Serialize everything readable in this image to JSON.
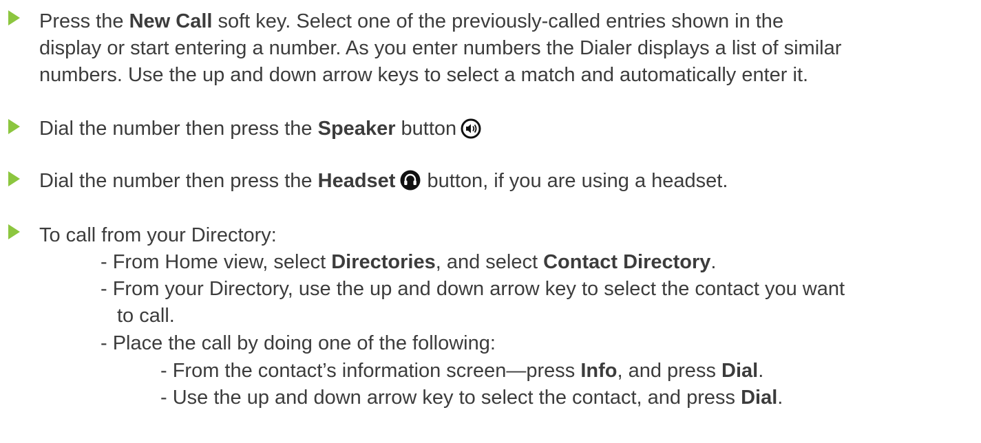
{
  "bullet1": {
    "line1_pre": "Press the ",
    "line1_bold": "New Call",
    "line1_post": " soft key. Select one of the previously-called entries shown in the",
    "line2": "display or start entering a number. As you enter numbers the Dialer displays a list of similar",
    "line3": "numbers. Use the up and down arrow keys to select a match and automatically enter it."
  },
  "bullet2": {
    "pre": "Dial the number then press the ",
    "bold": "Speaker",
    "post": " button",
    "icon": "speaker-icon"
  },
  "bullet3": {
    "pre": "Dial the number then press the ",
    "bold": "Headset",
    "post": " button, if you are using a headset.",
    "icon": "headset-icon"
  },
  "bullet4": {
    "text": "To call from your Directory:",
    "sub1": {
      "pre": "- From Home view, select ",
      "bold1": "Directories",
      "mid": ", and select ",
      "bold2": "Contact Directory",
      "post": "."
    },
    "sub2": {
      "line1": "- From your Directory, use the up and down arrow key to select the contact you want",
      "line2": "to call."
    },
    "sub3": {
      "text": "- Place the call by doing one of the following:",
      "a": {
        "pre": "- From the contact’s information screen—press ",
        "bold1": "Info",
        "mid": ", and press ",
        "bold2": "Dial",
        "post": "."
      },
      "b": {
        "pre": "- Use the up and down arrow key to select the contact, and press ",
        "bold": "Dial",
        "post": "."
      }
    }
  },
  "colors": {
    "bullet_arrow": "#8cc63f",
    "text": "#3c3c3c"
  }
}
